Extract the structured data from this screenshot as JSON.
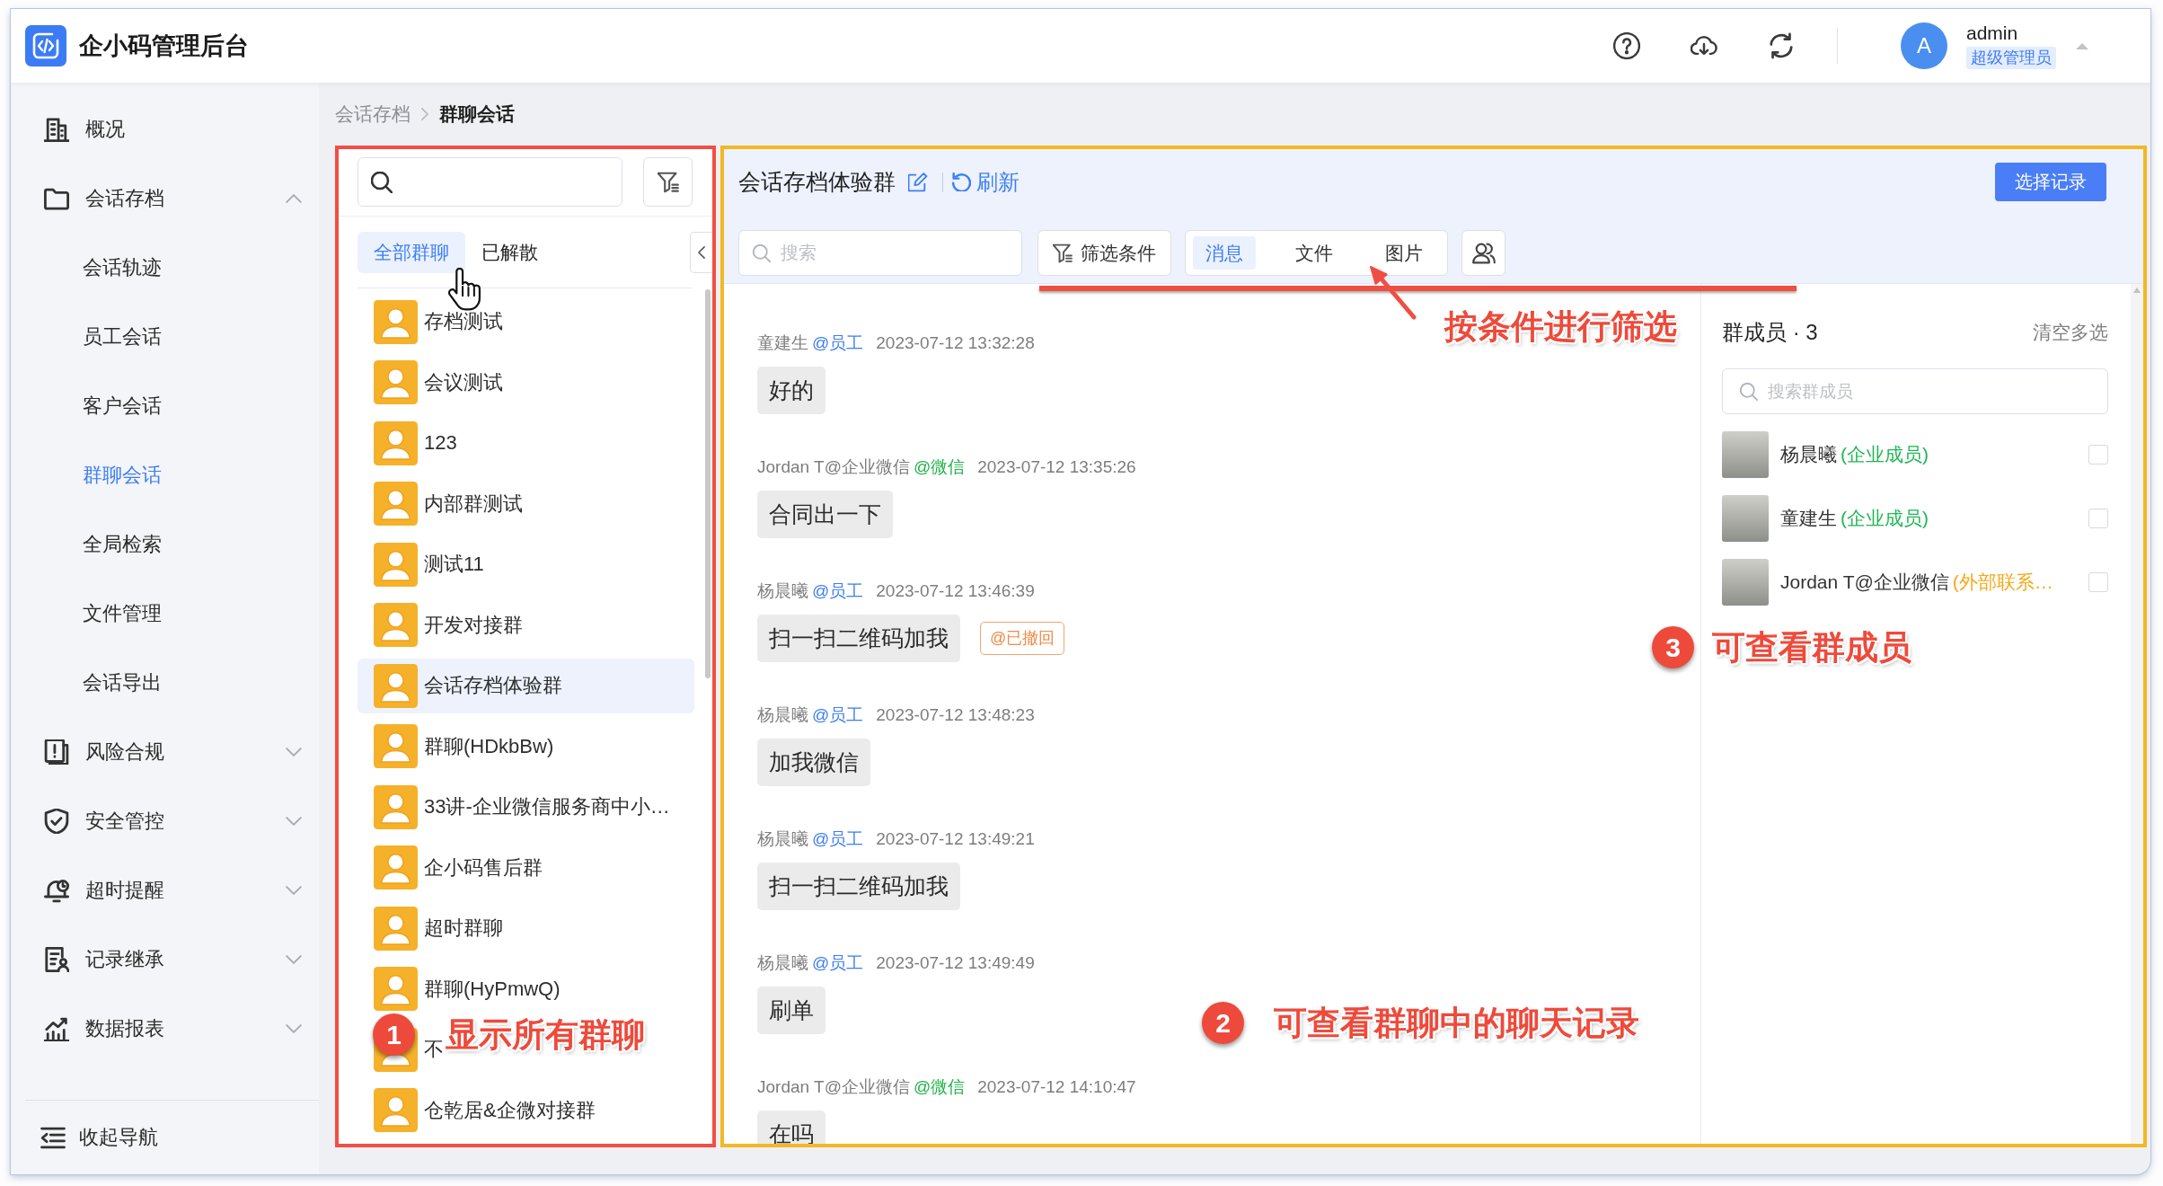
{
  "header": {
    "title": "企小码管理后台",
    "user": {
      "avatar_letter": "A",
      "name": "admin",
      "role": "超级管理员"
    }
  },
  "sidebar": {
    "items": [
      {
        "label": "概况",
        "kind": "link",
        "selected": false
      },
      {
        "label": "会话存档",
        "kind": "group",
        "expanded": true,
        "selected": false,
        "children": [
          {
            "label": "会话轨迹",
            "selected": false
          },
          {
            "label": "员工会话",
            "selected": false
          },
          {
            "label": "客户会话",
            "selected": false
          },
          {
            "label": "群聊会话",
            "selected": true
          },
          {
            "label": "全局检索",
            "selected": false
          },
          {
            "label": "文件管理",
            "selected": false
          },
          {
            "label": "会话导出",
            "selected": false
          }
        ]
      },
      {
        "label": "风险合规",
        "kind": "group",
        "expanded": false,
        "selected": false
      },
      {
        "label": "安全管控",
        "kind": "group",
        "expanded": false,
        "selected": false
      },
      {
        "label": "超时提醒",
        "kind": "group",
        "expanded": false,
        "selected": false
      },
      {
        "label": "记录继承",
        "kind": "group",
        "expanded": false,
        "selected": false
      },
      {
        "label": "数据报表",
        "kind": "group",
        "expanded": false,
        "selected": false
      }
    ],
    "collapse_label": "收起导航"
  },
  "breadcrumb": [
    "会话存档",
    "群聊会话"
  ],
  "group_list": {
    "tabs": [
      {
        "label": "全部群聊",
        "selected": true
      },
      {
        "label": "已解散",
        "selected": false
      }
    ],
    "groups": [
      {
        "name": "存档测试",
        "selected": false
      },
      {
        "name": "会议测试",
        "selected": false
      },
      {
        "name": "123",
        "selected": false
      },
      {
        "name": "内部群测试",
        "selected": false
      },
      {
        "name": "测试11",
        "selected": false
      },
      {
        "name": "开发对接群",
        "selected": false
      },
      {
        "name": "会话存档体验群",
        "selected": true
      },
      {
        "name": "群聊(HDkbBw)",
        "selected": false
      },
      {
        "name": "33讲-企业微信服务商中小…",
        "selected": false
      },
      {
        "name": "企小码售后群",
        "selected": false
      },
      {
        "name": "超时群聊",
        "selected": false
      },
      {
        "name": "群聊(HyPmwQ)",
        "selected": false
      },
      {
        "name": "不",
        "selected": false
      },
      {
        "name": "仓乾居&企微对接群",
        "selected": false
      }
    ]
  },
  "chat": {
    "title": "会话存档体验群",
    "refresh_label": "刷新",
    "select_button": "选择记录",
    "search": {
      "placeholder": "搜索"
    },
    "filter_button": "筛选条件",
    "tabs": [
      {
        "label": "消息",
        "selected": true
      },
      {
        "label": "文件",
        "selected": false
      },
      {
        "label": "图片",
        "selected": false
      }
    ],
    "messages": [
      {
        "sender": "童建生",
        "tag": {
          "text": "@员工",
          "kind": "staff"
        },
        "time": "2023-07-12 13:32:28",
        "text": "好的"
      },
      {
        "sender": "Jordan T@企业微信",
        "tag": {
          "text": "@微信",
          "kind": "wechat"
        },
        "time": "2023-07-12 13:35:26",
        "text": "合同出一下"
      },
      {
        "sender": "杨晨曦",
        "tag": {
          "text": "@员工",
          "kind": "staff"
        },
        "time": "2023-07-12 13:46:39",
        "text": "扫一扫二维码加我",
        "status": "@已撤回"
      },
      {
        "sender": "杨晨曦",
        "tag": {
          "text": "@员工",
          "kind": "staff"
        },
        "time": "2023-07-12 13:48:23",
        "text": "加我微信"
      },
      {
        "sender": "杨晨曦",
        "tag": {
          "text": "@员工",
          "kind": "staff"
        },
        "time": "2023-07-12 13:49:21",
        "text": "扫一扫二维码加我"
      },
      {
        "sender": "杨晨曦",
        "tag": {
          "text": "@员工",
          "kind": "staff"
        },
        "time": "2023-07-12 13:49:49",
        "text": "刷单"
      },
      {
        "sender": "Jordan T@企业微信",
        "tag": {
          "text": "@微信",
          "kind": "wechat"
        },
        "time": "2023-07-12 14:10:47",
        "text": "在吗"
      }
    ]
  },
  "members": {
    "title": "群成员 · 3",
    "clear_label": "清空多选",
    "search": {
      "placeholder": "搜索群成员"
    },
    "items": [
      {
        "name": "杨晨曦",
        "role": {
          "text": "(企业成员)",
          "kind": "internal"
        },
        "checked": false
      },
      {
        "name": "童建生",
        "role": {
          "text": "(企业成员)",
          "kind": "internal"
        },
        "checked": false
      },
      {
        "name": "Jordan T@企业微信",
        "role": {
          "text": "(外部联系…",
          "kind": "external"
        },
        "checked": false
      }
    ]
  },
  "annotations": [
    {
      "kind": "step",
      "number": "1",
      "text": "显示所有群聊"
    },
    {
      "kind": "step",
      "number": "2",
      "text": "可查看群聊中的聊天记录"
    },
    {
      "kind": "step",
      "number": "3",
      "text": "可查看群成员"
    },
    {
      "kind": "callout",
      "text": "按条件进行筛选"
    }
  ]
}
